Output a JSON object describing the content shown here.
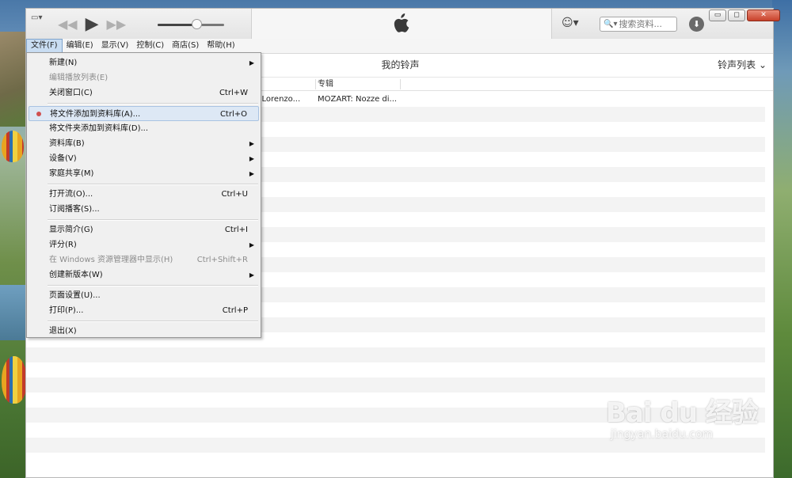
{
  "player": {
    "sidebar_toggle": "▭▾",
    "prev_icon": "◀◀",
    "play_icon": "▶",
    "next_icon": "▶▶",
    "volume_level": 0.58,
    "account_icon": "☺▾",
    "search_icon": "🔍▾",
    "search_placeholder": "搜索资料...",
    "download_icon": "⬇",
    "minimize": "▭",
    "maximize": "◻",
    "close": "✕"
  },
  "menubar": {
    "items": [
      "文件(F)",
      "编辑(E)",
      "显示(V)",
      "控制(C)",
      "商店(S)",
      "帮助(H)"
    ]
  },
  "view": {
    "title": "我的铃声",
    "view_menu": "铃声列表 ⌄"
  },
  "table": {
    "headers": [
      "专辑"
    ],
    "rows": [
      {
        "artist": "e, Lorenzo...",
        "album": "MOZART: Nozze di..."
      }
    ]
  },
  "file_menu": {
    "items": [
      {
        "label": "新建(N)",
        "shortcut": "",
        "submenu": true,
        "disabled": false
      },
      {
        "label": "编辑播放列表(E)",
        "shortcut": "",
        "submenu": false,
        "disabled": true
      },
      {
        "label": "关闭窗口(C)",
        "shortcut": "Ctrl+W",
        "submenu": false,
        "disabled": false
      },
      {
        "label": "将文件添加到资料库(A)...",
        "shortcut": "Ctrl+O",
        "submenu": false,
        "disabled": false,
        "highlighted": true
      },
      {
        "label": "将文件夹添加到资料库(D)...",
        "shortcut": "",
        "submenu": false,
        "disabled": false
      },
      {
        "label": "资料库(B)",
        "shortcut": "",
        "submenu": true,
        "disabled": false
      },
      {
        "label": "设备(V)",
        "shortcut": "",
        "submenu": true,
        "disabled": false
      },
      {
        "label": "家庭共享(M)",
        "shortcut": "",
        "submenu": true,
        "disabled": false
      },
      {
        "label": "打开流(O)...",
        "shortcut": "Ctrl+U",
        "submenu": false,
        "disabled": false
      },
      {
        "label": "订阅播客(S)...",
        "shortcut": "",
        "submenu": false,
        "disabled": false
      },
      {
        "label": "显示简介(G)",
        "shortcut": "Ctrl+I",
        "submenu": false,
        "disabled": false
      },
      {
        "label": "评分(R)",
        "shortcut": "",
        "submenu": true,
        "disabled": false
      },
      {
        "label": "在 Windows 资源管理器中显示(H)",
        "shortcut": "Ctrl+Shift+R",
        "submenu": false,
        "disabled": true
      },
      {
        "label": "创建新版本(W)",
        "shortcut": "",
        "submenu": true,
        "disabled": false
      },
      {
        "label": "页面设置(U)...",
        "shortcut": "",
        "submenu": false,
        "disabled": false
      },
      {
        "label": "打印(P)...",
        "shortcut": "Ctrl+P",
        "submenu": false,
        "disabled": false
      },
      {
        "label": "退出(X)",
        "shortcut": "",
        "submenu": false,
        "disabled": false
      }
    ]
  },
  "watermark": {
    "brand": "Bai du 经验",
    "url": "jingyan.baidu.com"
  },
  "colors": {
    "highlight": "#dde8f5",
    "stripe": "#f3f3f3",
    "menubar_active": "#c9ddf2"
  }
}
